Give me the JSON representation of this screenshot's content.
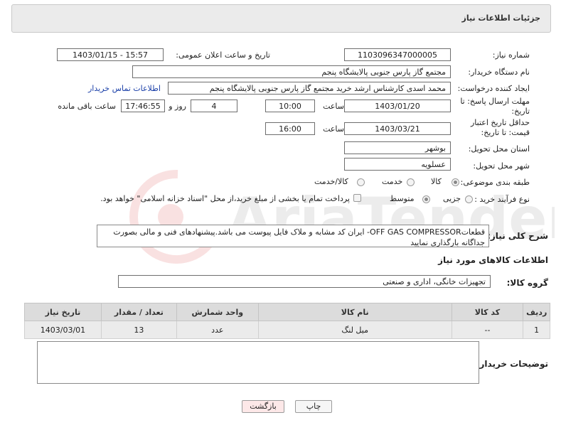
{
  "header": {
    "title": "جزئیات اطلاعات نیاز"
  },
  "form": {
    "need_number_label": "شماره نیاز:",
    "need_number": "1103096347000005",
    "announce_label": "تاریخ و ساعت اعلان عمومی:",
    "announce_value": "1403/01/15 - 15:57",
    "buyer_org_label": "نام دستگاه خریدار:",
    "buyer_org": "مجتمع گاز پارس جنوبی  پالایشگاه پنجم",
    "requester_label": "ایجاد کننده درخواست:",
    "requester": "محمد اسدی کارشناس ارشد خرید مجتمع گاز پارس جنوبی  پالایشگاه پنجم",
    "contact_link": "اطلاعات تماس خریدار",
    "reply_deadline_label": "مهلت ارسال پاسخ: تا تاریخ:",
    "reply_date": "1403/01/20",
    "time_label": "ساعت",
    "reply_time": "10:00",
    "days_value": "4",
    "days_label": "روز و",
    "remaining_time": "17:46:55",
    "remaining_label": "ساعت باقی مانده",
    "validity_label": "حداقل تاریخ اعتبار قیمت: تا تاریخ:",
    "validity_date": "1403/03/21",
    "validity_time": "16:00",
    "province_label": "استان محل تحویل:",
    "province": "بوشهر",
    "city_label": "شهر محل تحویل:",
    "city": "عسلویه",
    "category_label": "طبقه بندی موضوعی:",
    "category_options": [
      "کالا",
      "خدمت",
      "کالا/خدمت"
    ],
    "process_label": "نوع فرآیند خرید :",
    "process_options": [
      "جزیی",
      "متوسط"
    ],
    "payment_note": "پرداخت تمام یا بخشی از مبلغ خرید،از محل \"اسناد خزانه اسلامی\" خواهد بود."
  },
  "description": {
    "label": "شرح کلی نیاز:",
    "text": "قطعاتOFF GAS COMPRESSOR- ایران کد مشابه و ملاک فایل پیوست می باشد.پیشنهادهای فنی و مالی بصورت جداگانه بارگذاری نمایید"
  },
  "goods": {
    "section_title": "اطلاعات کالاهای مورد نیاز",
    "group_label": "گروه کالا:",
    "group_value": "تجهیزات خانگی، اداری و صنعتی",
    "columns": [
      "ردیف",
      "کد کالا",
      "نام کالا",
      "واحد شمارش",
      "تعداد / مقدار",
      "تاریخ نیاز"
    ],
    "rows": [
      {
        "index": "1",
        "code": "--",
        "name": "میل لنگ",
        "unit": "عدد",
        "qty": "13",
        "date": "1403/03/01"
      }
    ]
  },
  "buyer_notes": {
    "label": "توضیحات خریدار:",
    "value": ""
  },
  "buttons": {
    "print": "چاپ",
    "back": "بازگشت"
  },
  "watermark_text": "AriaTender.neT",
  "colors": {
    "link": "#1a3fa8",
    "back_button_bg": "#fde8e8",
    "watermark": "#d22020"
  }
}
